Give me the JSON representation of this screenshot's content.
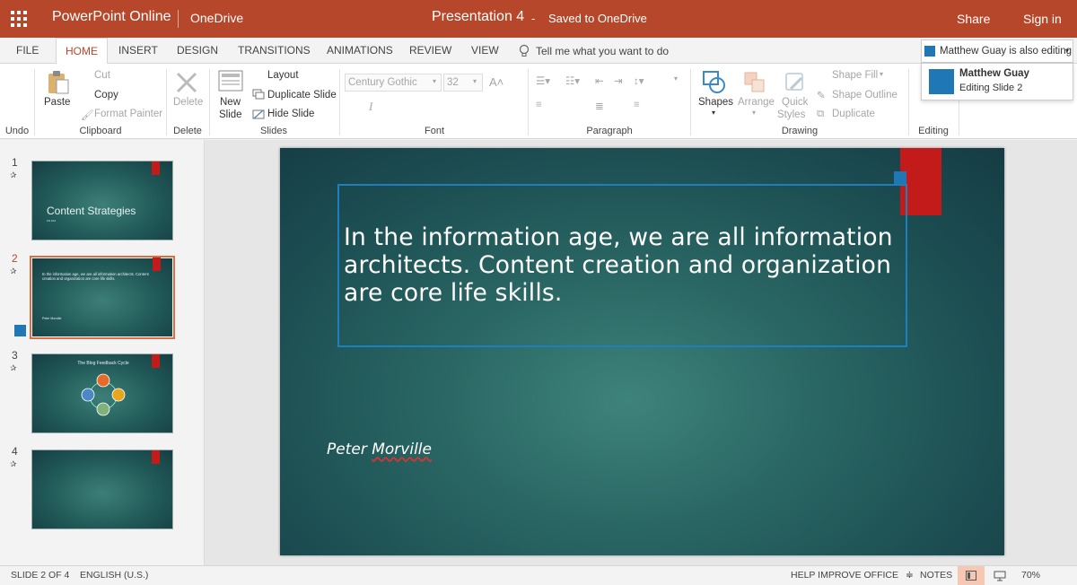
{
  "topbar": {
    "app_name": "PowerPoint Online",
    "location": "OneDrive",
    "doc_title": "Presentation 4",
    "dash": "-",
    "save_status": "Saved to OneDrive",
    "share": "Share",
    "sign_in": "Sign in"
  },
  "tabs": {
    "file": "FILE",
    "home": "HOME",
    "insert": "INSERT",
    "design": "DESIGN",
    "transitions": "TRANSITIONS",
    "animations": "ANIMATIONS",
    "review": "REVIEW",
    "view": "VIEW",
    "active": "HOME"
  },
  "tell_me": "Tell me what you want to do",
  "coauthor": {
    "button_label": "Matthew Guay is also editing",
    "name": "Matthew Guay",
    "status": "Editing Slide 2",
    "color": "#1f77b4"
  },
  "ribbon": {
    "undo": {
      "group": "Undo"
    },
    "clipboard": {
      "paste": "Paste",
      "cut": "Cut",
      "copy": "Copy",
      "format_painter": "Format Painter",
      "group": "Clipboard"
    },
    "delete": {
      "delete": "Delete",
      "group": "Delete"
    },
    "slides": {
      "new_slide_1": "New",
      "new_slide_2": "Slide",
      "layout": "Layout",
      "duplicate": "Duplicate Slide",
      "hide": "Hide Slide",
      "group": "Slides"
    },
    "font": {
      "font_name": "Century Gothic",
      "font_size": "32",
      "italic": "I",
      "group": "Font"
    },
    "paragraph": {
      "group": "Paragraph"
    },
    "drawing": {
      "shapes": "Shapes",
      "arrange": "Arrange",
      "quick_styles_1": "Quick",
      "quick_styles_2": "Styles",
      "shape_fill": "Shape Fill",
      "shape_outline": "Shape Outline",
      "duplicate": "Duplicate",
      "group": "Drawing"
    },
    "editing": {
      "group": "Editing"
    }
  },
  "slides": [
    {
      "number": "1",
      "title": "Content Strategies",
      "subtitle": "CS 101"
    },
    {
      "number": "2",
      "body": "In the information age, we are all information architects. Content creation and organization are core life skills.",
      "signature": "Peter Morville",
      "selected": true
    },
    {
      "number": "3",
      "title": "The Blog Feedback Cycle"
    },
    {
      "number": "4"
    }
  ],
  "current_slide": {
    "body": "In the information age, we are all information architects. Content creation and organization are core life skills.",
    "signature_first": "Peter ",
    "signature_last": "Morville"
  },
  "statusbar": {
    "slide_of": "SLIDE 2 OF 4",
    "language": "ENGLISH (U.S.)",
    "help": "HELP IMPROVE OFFICE",
    "notes": "NOTES",
    "zoom": "70%"
  },
  "colors": {
    "brand": "#b7472a",
    "accent_blue": "#1f77b4",
    "slide_accent": "#c31a1a",
    "selected_thumb": "#e06b3f"
  }
}
